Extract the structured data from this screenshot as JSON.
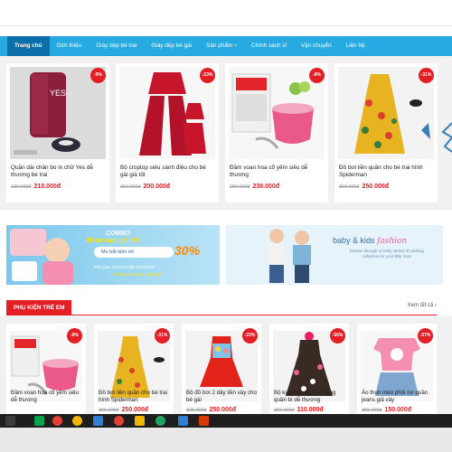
{
  "nav": {
    "items": [
      {
        "label": "Trang chủ",
        "active": true,
        "dropdown": false
      },
      {
        "label": "Giới thiệu",
        "active": false,
        "dropdown": false
      },
      {
        "label": "Giày dép bé trai",
        "active": false,
        "dropdown": false
      },
      {
        "label": "Giày dép bé gái",
        "active": false,
        "dropdown": false
      },
      {
        "label": "Sản phẩm",
        "active": false,
        "dropdown": true
      },
      {
        "label": "Chính sách sỉ",
        "active": false,
        "dropdown": false
      },
      {
        "label": "Vận chuyển",
        "active": false,
        "dropdown": false
      },
      {
        "label": "Liên hệ",
        "active": false,
        "dropdown": false
      }
    ],
    "caret": "˅"
  },
  "products_top": [
    {
      "name": "Quần dài chân bo in chữ Yes dễ thương bé trai",
      "discount": "-9%",
      "old_price": "230.000đ",
      "price": "210.000đ"
    },
    {
      "name": "Bộ croptop siêu sành điệu cho bé gái giá tốt",
      "discount": "-23%",
      "old_price": "260.000đ",
      "price": "200.000đ"
    },
    {
      "name": "Đầm voan hoa cổ yếm siêu dễ thương",
      "discount": "-8%",
      "old_price": "250.000đ",
      "price": "230.000đ"
    },
    {
      "name": "Đồ bơi liền quần cho bé trai hình Spiderman",
      "discount": "-31%",
      "old_price": "360.000đ",
      "price": "250.000đ"
    }
  ],
  "banners": {
    "combo": {
      "combo": "COMBO",
      "subtitle": "đồ sơ sinh giá tốt",
      "me_text": "Mẹ bắt kiện tới",
      "percent": "30%",
      "date": "Thời gian: 2/4/2018 đến 30/4/2018",
      "note": "Khu vực áp dụng: Miền Bắc"
    },
    "fashion": {
      "title": "baby & kids",
      "title_accent": "fashion",
      "subtitle": "browse through a lovely variety of clothing collection for your little ones"
    }
  },
  "section": {
    "title": "PHỤ KIỆN TRẺ EM",
    "more": "Xem tất cả",
    "more_icon": "›"
  },
  "products_bottom": [
    {
      "name": "Đầm voan hoa cổ yếm siêu dễ thương",
      "discount": "-8%",
      "old_price": "",
      "price": ""
    },
    {
      "name": "Đồ bơi liền quần cho bé trai hình Spiderman",
      "discount": "-31%",
      "old_price": "360.000đ",
      "price": "250.000đ"
    },
    {
      "name": "Bộ đồ bơi 2 dây liền váy cho bé gái",
      "discount": "-23%",
      "old_price": "325.000đ",
      "price": "250.000đ"
    },
    {
      "name": "Bộ kate hai dây bèo tầng quần bí dễ thương",
      "discount": "-56%",
      "old_price": "250.000đ",
      "price": "110.000đ"
    },
    {
      "name": "Áo thun mèo phối nơ quần jeans giả váy",
      "discount": "-57%",
      "old_price": "350.000đ",
      "price": "150.000đ"
    }
  ],
  "colors": {
    "nav": "#27a9e1",
    "nav_active": "#0d6fa9",
    "accent": "#e31e24"
  }
}
